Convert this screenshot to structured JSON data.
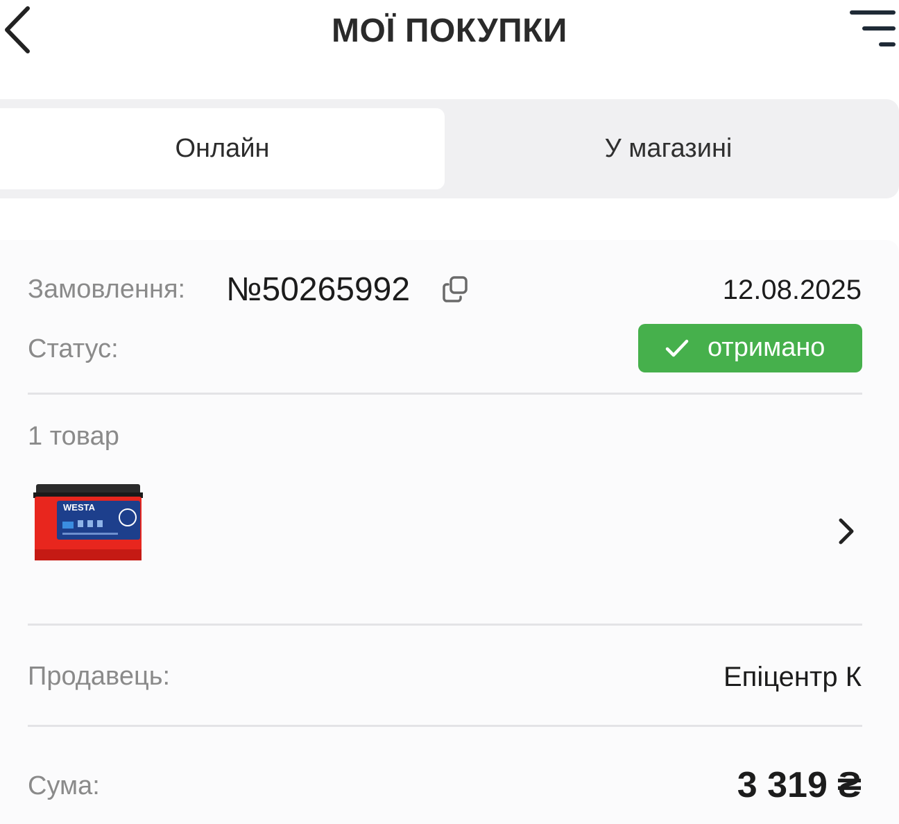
{
  "header": {
    "title": "МОЇ ПОКУПКИ",
    "back_icon": "chevron-left-icon",
    "menu_icon": "filter-lines-icon"
  },
  "tabs": [
    {
      "label": "Онлайн",
      "selected": true
    },
    {
      "label": "У магазині",
      "selected": false
    }
  ],
  "order": {
    "order_label": "Замовлення:",
    "order_number": "№50265992",
    "copy_icon": "copy-icon",
    "date": "12.08.2025",
    "status_label": "Статус:",
    "status_value": "отримано",
    "status_icon": "check-icon",
    "status_color": "#46b04c",
    "items_count": "1 товар",
    "product": {
      "brand": "WESTA",
      "image_icon": "car-battery-icon",
      "link_icon": "chevron-right-icon"
    },
    "seller_label": "Продавець:",
    "seller_value": "Епіцентр К",
    "sum_label": "Сума:",
    "sum_value": "3 319 ₴"
  }
}
